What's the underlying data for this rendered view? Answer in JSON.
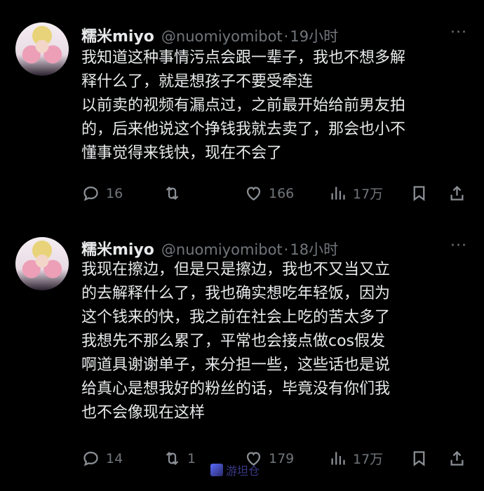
{
  "tweets": [
    {
      "name": "糯米miyo",
      "handle": "@nuomiyomibot",
      "separator": "·",
      "time": "19小时",
      "more": "···",
      "text": "我知道这种事情污点会跟一辈子，我也不想多解\n释什么了，就是想孩子不要受牵连\n以前卖的视频有漏点过，之前最开始给前男友拍\n的，后来他说这个挣钱我就去卖了，那会也小不\n懂事觉得来钱快，现在不会了",
      "replies": "16",
      "retweets": "",
      "likes": "166",
      "views": "17万"
    },
    {
      "name": "糯米miyo",
      "handle": "@nuomiyomibot",
      "separator": "·",
      "time": "18小时",
      "more": "···",
      "text": "我现在擦边，但是只是擦边，我也不又当又立\n的去解释什么了，我也确实想吃年轻饭，因为\n这个钱来的快，我之前在社会上吃的苦太多了\n我想先不那么累了，平常也会接点做cos假发\n啊道具谢谢单子，来分担一些，这些话也是说\n给真心是想我好的粉丝的话，毕竟没有你们我\n也不会像现在这样",
      "replies": "14",
      "retweets": "1",
      "likes": "179",
      "views": "17万"
    }
  ],
  "watermark": "游坦仓"
}
